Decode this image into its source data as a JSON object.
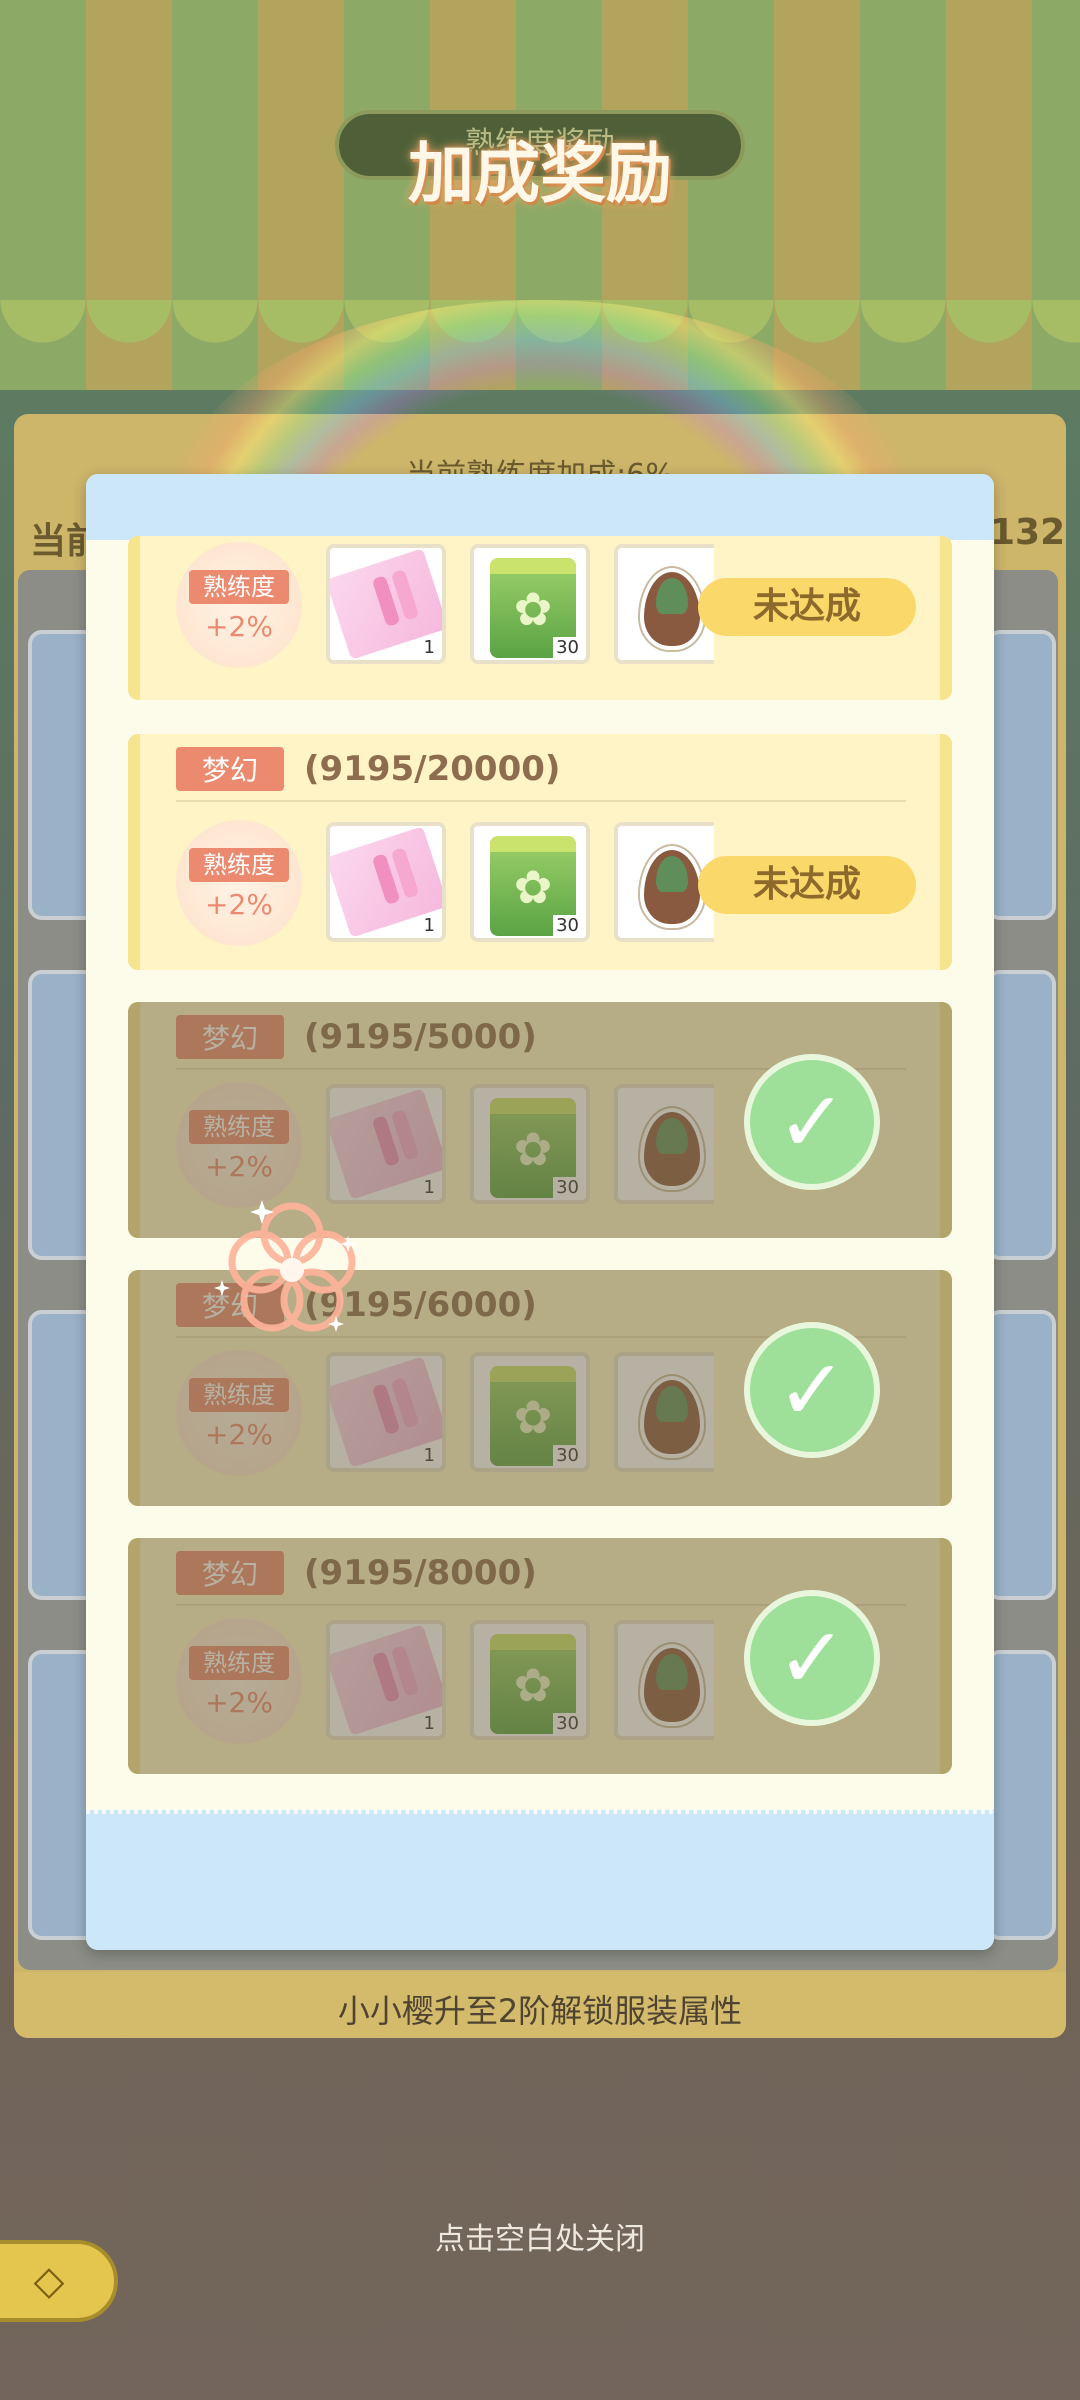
{
  "background": {
    "title_plate_sub": "熟练度奖励",
    "banner_text": "当前熟练度加成:6%",
    "left_text": "当前",
    "right_number": "132",
    "bottom_text": "小小樱升至2阶解锁服装属性"
  },
  "title": "加成奖励",
  "close_hint": "点击空白处关闭",
  "back_button": "◇",
  "tiers": [
    {
      "badge": "",
      "progress": "",
      "bonus_tag": "熟练度",
      "bonus_value": "+2%",
      "item1_qty": "1",
      "item2_qty": "30",
      "status": "未达成",
      "achieved": false
    },
    {
      "badge": "梦幻",
      "progress": "(9195/20000)",
      "bonus_tag": "熟练度",
      "bonus_value": "+2%",
      "item1_qty": "1",
      "item2_qty": "30",
      "status": "未达成",
      "achieved": false
    },
    {
      "badge": "梦幻",
      "progress": "(9195/5000)",
      "bonus_tag": "熟练度",
      "bonus_value": "+2%",
      "item1_qty": "1",
      "item2_qty": "30",
      "status": "",
      "achieved": true
    },
    {
      "badge": "梦幻",
      "progress": "(9195/6000)",
      "bonus_tag": "熟练度",
      "bonus_value": "+2%",
      "item1_qty": "1",
      "item2_qty": "30",
      "status": "",
      "achieved": true
    },
    {
      "badge": "梦幻",
      "progress": "(9195/8000)",
      "bonus_tag": "熟练度",
      "bonus_value": "+2%",
      "item1_qty": "1",
      "item2_qty": "30",
      "status": "",
      "achieved": true
    }
  ],
  "icons": {
    "item1": "ticket-icon",
    "item2": "seed-bag-icon",
    "item3": "seed-icon",
    "achieved": "check-icon"
  },
  "colors": {
    "badge": "#ec8a70",
    "status_button": "#fbd86a",
    "check": "#9ee09a",
    "modal_header": "#cbe7f8"
  }
}
